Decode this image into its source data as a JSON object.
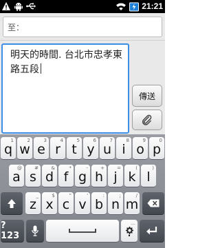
{
  "status_bar": {
    "icons_left": [
      "warning-icon",
      "android-icon",
      "usb-icon"
    ],
    "icons_right": [
      "wifi-icon",
      "battery-icon"
    ],
    "time": "21:21"
  },
  "compose": {
    "to_label": "至：",
    "message_text": "明天的時間. 台北市忠孝東路五段",
    "send_label": "傳送",
    "attach_icon": "paperclip-icon"
  },
  "keyboard": {
    "row1": [
      {
        "main": "q",
        "hint": "1"
      },
      {
        "main": "w",
        "hint": "2"
      },
      {
        "main": "e",
        "hint": "3"
      },
      {
        "main": "r",
        "hint": "4"
      },
      {
        "main": "t",
        "hint": "5"
      },
      {
        "main": "y",
        "hint": "6"
      },
      {
        "main": "u",
        "hint": "7"
      },
      {
        "main": "i",
        "hint": "8"
      },
      {
        "main": "o",
        "hint": "9"
      },
      {
        "main": "p",
        "hint": "0"
      }
    ],
    "row2": [
      {
        "main": "a",
        "hint": "@"
      },
      {
        "main": "s",
        "hint": "#"
      },
      {
        "main": "d",
        "hint": "&"
      },
      {
        "main": "f",
        "hint": "*"
      },
      {
        "main": "g",
        "hint": "-"
      },
      {
        "main": "h",
        "hint": "+"
      },
      {
        "main": "j",
        "hint": "="
      },
      {
        "main": "k",
        "hint": "("
      },
      {
        "main": "l",
        "hint": ")"
      }
    ],
    "row3": [
      {
        "main": "z",
        "hint": "_"
      },
      {
        "main": "x",
        "hint": "$"
      },
      {
        "main": "c",
        "hint": "\""
      },
      {
        "main": "v",
        "hint": "'"
      },
      {
        "main": "b",
        "hint": ":"
      },
      {
        "main": "n",
        "hint": ";"
      },
      {
        "main": "m",
        "hint": "/"
      }
    ],
    "symbols_label": "?123",
    "period_label": ".",
    "period_hint": "…",
    "key_icons": {
      "shift": "shift-arrow-icon",
      "delete": "backspace-icon",
      "mic": "microphone-icon",
      "settings": "gear-icon",
      "enter": "enter-icon",
      "space": "space-bar-icon"
    }
  }
}
